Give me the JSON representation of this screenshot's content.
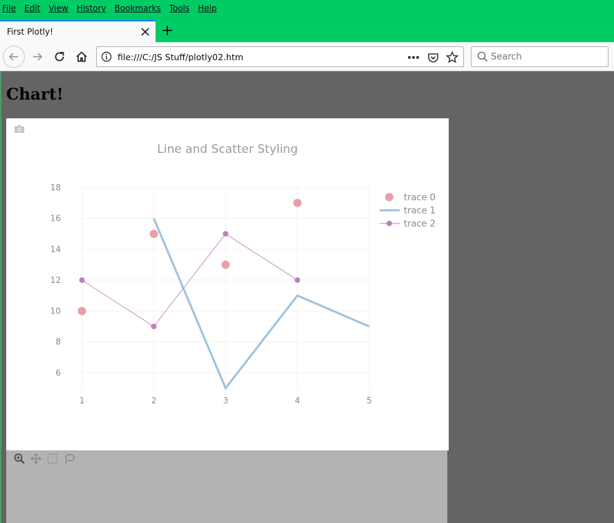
{
  "menu": {
    "items": [
      {
        "key": "F",
        "rest": "ile"
      },
      {
        "key": "E",
        "rest": "dit"
      },
      {
        "key": "V",
        "rest": "iew"
      },
      {
        "key": "",
        "pre": "Hi",
        "mid": "s",
        "post": "tory"
      },
      {
        "key": "B",
        "rest": "ookmarks"
      },
      {
        "key": "T",
        "rest": "ools"
      },
      {
        "key": "H",
        "rest": "elp"
      }
    ],
    "labels": [
      "File",
      "Edit",
      "View",
      "History",
      "Bookmarks",
      "Tools",
      "Help"
    ]
  },
  "tab": {
    "title": "First Plotly!"
  },
  "nav": {
    "url": "file:///C:/JS Stuff/plotly02.htm",
    "search_placeholder": "Search"
  },
  "page": {
    "heading": "Chart!"
  },
  "chart_data": {
    "type": "scatter",
    "title": "Line and Scatter Styling",
    "xlim": [
      0.995,
      5.0
    ],
    "ylim": [
      4.2,
      18.0
    ],
    "xticks": [
      1,
      2,
      3,
      4,
      5
    ],
    "yticks": [
      6,
      8,
      10,
      12,
      14,
      16,
      18
    ],
    "grid": true,
    "legend_position": "top-right",
    "series": [
      {
        "name": "trace 0",
        "mode": "markers",
        "color": "#e8a0a8",
        "x": [
          1,
          2,
          3,
          4
        ],
        "y": [
          10,
          15,
          13,
          17
        ]
      },
      {
        "name": "trace 1",
        "mode": "lines",
        "color": "#9cc3de",
        "x": [
          2,
          3,
          4,
          5
        ],
        "y": [
          16,
          5,
          11,
          9
        ]
      },
      {
        "name": "trace 2",
        "mode": "lines+markers",
        "color": "#bf7fbf",
        "x": [
          1,
          2,
          3,
          4
        ],
        "y": [
          12,
          9,
          15,
          12
        ]
      }
    ]
  }
}
